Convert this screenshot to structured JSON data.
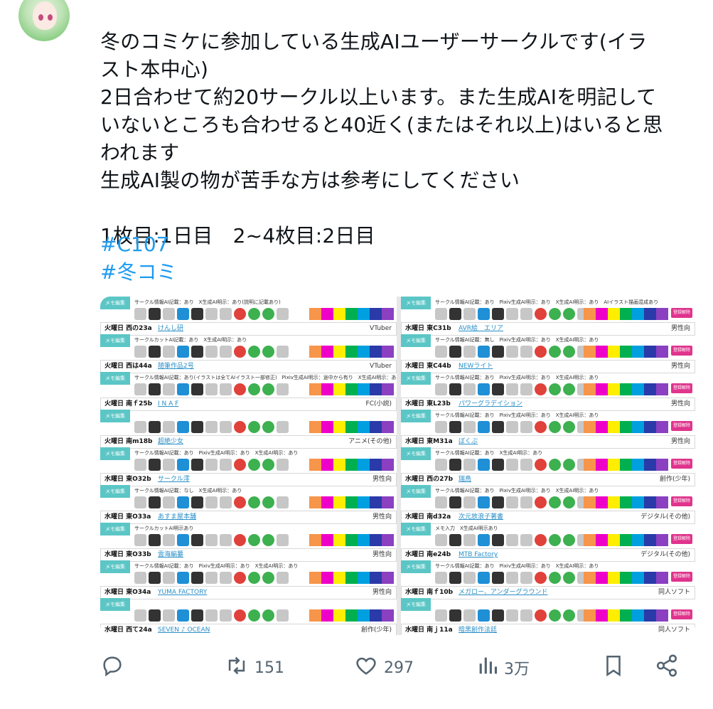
{
  "post": {
    "text_lines": [
      "冬のコミケに参加している生成AIユーザーサークルです(イラ",
      "スト本中心)",
      "2日合わせて約20サークル以上います。また生成AIを明記して",
      "いないところも合わせると40近く(またはそれ以上)はいると思",
      "われます",
      "生成AI製の物が苦手な方は参考にしてください",
      "",
      "1枚目:1日目　2~4枚目:2日目"
    ],
    "hashtags": [
      "#C107",
      "#冬コミ"
    ]
  },
  "media": {
    "left_rows": [
      {
        "day": "火曜日 西の23a",
        "name": "けんし研",
        "genre": "VTuber",
        "memo_label": "メモ編集",
        "memo_text": "サークル情報AI記載：あり　X生成AI明示：あり(説明に記載あり)"
      },
      {
        "day": "火曜日 西は44a",
        "name": "随筆作品2号",
        "genre": "VTuber",
        "memo_label": "メモ編集",
        "memo_text": "サークルカットAI記載：あり　X生成AI明示：あり"
      },
      {
        "day": "火曜日 南ｆ25b",
        "name": "I N A F",
        "genre": "FC(小説)",
        "memo_label": "メモ編集",
        "memo_text": "サークル情報AI記載：あり(イラストは全てAIイラスト一部修正)　Pixiv生成AI明示：途中から有り　X生成AI明示：あり"
      },
      {
        "day": "火曜日 南m18b",
        "name": "超絶少女",
        "genre": "アニメ(その他)",
        "memo_label": "メモ編集",
        "memo_text": ""
      },
      {
        "day": "水曜日 東O32b",
        "name": "サークル澪",
        "genre": "男性向",
        "memo_label": "メモ編集",
        "memo_text": "サークル情報AI記載：あり　Pixiv生成AI明示：あり　X生成AI明示：あり"
      },
      {
        "day": "水曜日 東O33a",
        "name": "あすま屋本舗",
        "genre": "男性向",
        "memo_label": "メモ編集",
        "memo_text": "サークル情報AI記載：なし　X生成AI明示：あり"
      },
      {
        "day": "水曜日 東O33b",
        "name": "雲海編纂",
        "genre": "男性向",
        "memo_label": "メモ編集",
        "memo_text": "サークルカットAI明示あり"
      },
      {
        "day": "水曜日 東O34a",
        "name": "YUMA FACTORY",
        "genre": "男性向",
        "memo_label": "メモ編集",
        "memo_text": "サークル情報AI記載：あり　Pixiv生成AI明示：あり　X生成AI明示：あり"
      },
      {
        "day": "水曜日 西て24a",
        "name": "SEVEN ♪ OCEAN",
        "genre": "創作(少年)",
        "memo_label": "メモ編集",
        "memo_text": ""
      }
    ],
    "right_rows": [
      {
        "day": "水曜日 東C31b",
        "name": "AVR絵　エリア",
        "genre": "男性向",
        "memo_label": "メモ編集",
        "memo_text": "サークル情報AI記載：あり　Pixiv生成AI明示：あり　X生成AI明示：あり　AIイラスト描画混成あり"
      },
      {
        "day": "水曜日 東C44b",
        "name": "NEWライト",
        "genre": "男性向",
        "memo_label": "メモ編集",
        "memo_text": "サークル情報AI記載：無し　Pixiv生成AI明示：あり　X生成AI明示：あり"
      },
      {
        "day": "水曜日 東L23b",
        "name": "パワーグラデイション",
        "genre": "男性向",
        "memo_label": "メモ編集",
        "memo_text": "サークル情報AI記載：あり　Pixiv生成AI明示：あり　X生成AI明示：あり"
      },
      {
        "day": "水曜日 東M31a",
        "name": "ぼくぶ",
        "genre": "男性向",
        "memo_label": "メモ編集",
        "memo_text": "サークル情報AI記載：あり　Pixiv生成AI明示：あり　X生成AI明示：あり"
      },
      {
        "day": "水曜日 西の27b",
        "name": "瑞鳥",
        "genre": "創作(少年)",
        "memo_label": "メモ編集",
        "memo_text": "サークル情報AI記載：あり　X生成AI明示：あり"
      },
      {
        "day": "水曜日 南d32a",
        "name": "次元放浪子著書",
        "genre": "デジタル(その他)",
        "memo_label": "メモ編集",
        "memo_text": "サークル情報AI記載：あり　Pixiv生成AI明示：あり　X生成AI明示：あり"
      },
      {
        "day": "水曜日 南e24b",
        "name": "MTB Factory",
        "genre": "デジタル(その他)",
        "memo_label": "メモ編集",
        "memo_text": "メモ入力　X生成AI明示あり"
      },
      {
        "day": "水曜日 南ｆ10b",
        "name": "メガロー、アンダーグラウンド",
        "genre": "同人ソフト",
        "memo_label": "メモ編集",
        "memo_text": "サークル情報AI記載：あり　Pixiv生成AI明示：あり　X生成AI明示：あり"
      },
      {
        "day": "水曜日 南ｊ11a",
        "name": "暗黒創作法廷",
        "genre": "同人ソフト",
        "memo_label": "メモ編集",
        "memo_text": ""
      }
    ],
    "reg_label": "登録解除",
    "color_swatches": [
      "#f7954a",
      "#ee00c8",
      "#ffee00",
      "#00b050",
      "#00a0e0",
      "#2a3aa8",
      "#8a40c0"
    ]
  },
  "actions": {
    "reply": {
      "icon": "reply-icon",
      "count": ""
    },
    "retweet": {
      "icon": "retweet-icon",
      "count": "151"
    },
    "like": {
      "icon": "heart-icon",
      "count": "297"
    },
    "views": {
      "icon": "bar-chart-icon",
      "count": "3万"
    },
    "bookmark": {
      "icon": "bookmark-icon"
    },
    "share": {
      "icon": "share-icon"
    }
  }
}
